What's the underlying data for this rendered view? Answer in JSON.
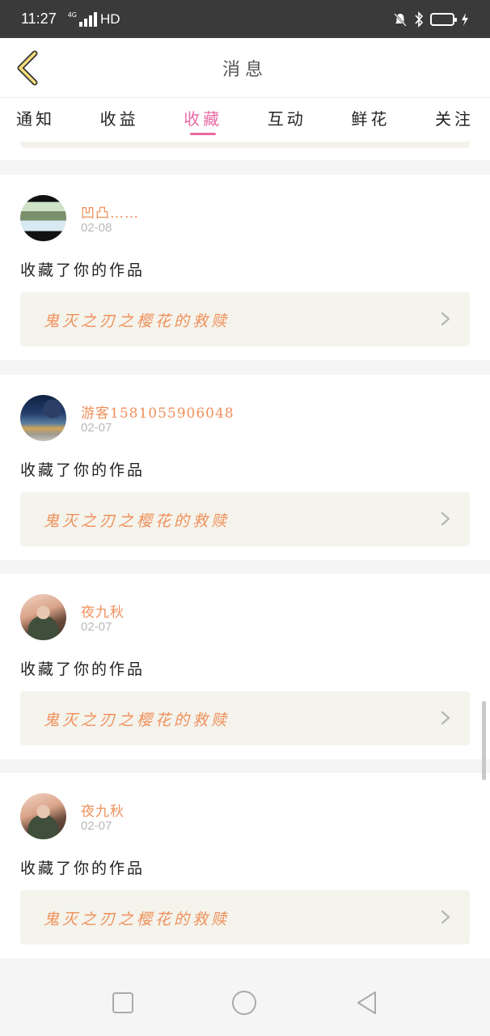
{
  "status_bar": {
    "time": "11:27",
    "network_tag": "4G",
    "network": "HD"
  },
  "header": {
    "title": "消息"
  },
  "tabs": [
    {
      "label": "通知",
      "active": false
    },
    {
      "label": "收益",
      "active": false
    },
    {
      "label": "收藏",
      "active": true
    },
    {
      "label": "互动",
      "active": false
    },
    {
      "label": "鲜花",
      "active": false
    },
    {
      "label": "关注",
      "active": false
    }
  ],
  "messages": [
    {
      "user": "凹凸……",
      "time": "02-08",
      "action": "收藏了你的作品",
      "work": "鬼灭之刃之樱花的救赎"
    },
    {
      "user": "游客1581055906048",
      "time": "02-07",
      "action": "收藏了你的作品",
      "work": "鬼灭之刃之樱花的救赎"
    },
    {
      "user": "夜九秋",
      "time": "02-07",
      "action": "收藏了你的作品",
      "work": "鬼灭之刃之樱花的救赎"
    },
    {
      "user": "夜九秋",
      "time": "02-07",
      "action": "收藏了你的作品",
      "work": "鬼灭之刃之樱花的救赎"
    }
  ],
  "colors": {
    "accent_pink": "#e96ba5",
    "accent_orange": "#f0905a",
    "back_icon_fill": "#f5dc7a"
  },
  "icons": {
    "back": "back-arrow-icon",
    "chevron": "chevron-right-icon",
    "nav_recent": "square-icon",
    "nav_home": "circle-icon",
    "nav_back": "triangle-back-icon"
  }
}
